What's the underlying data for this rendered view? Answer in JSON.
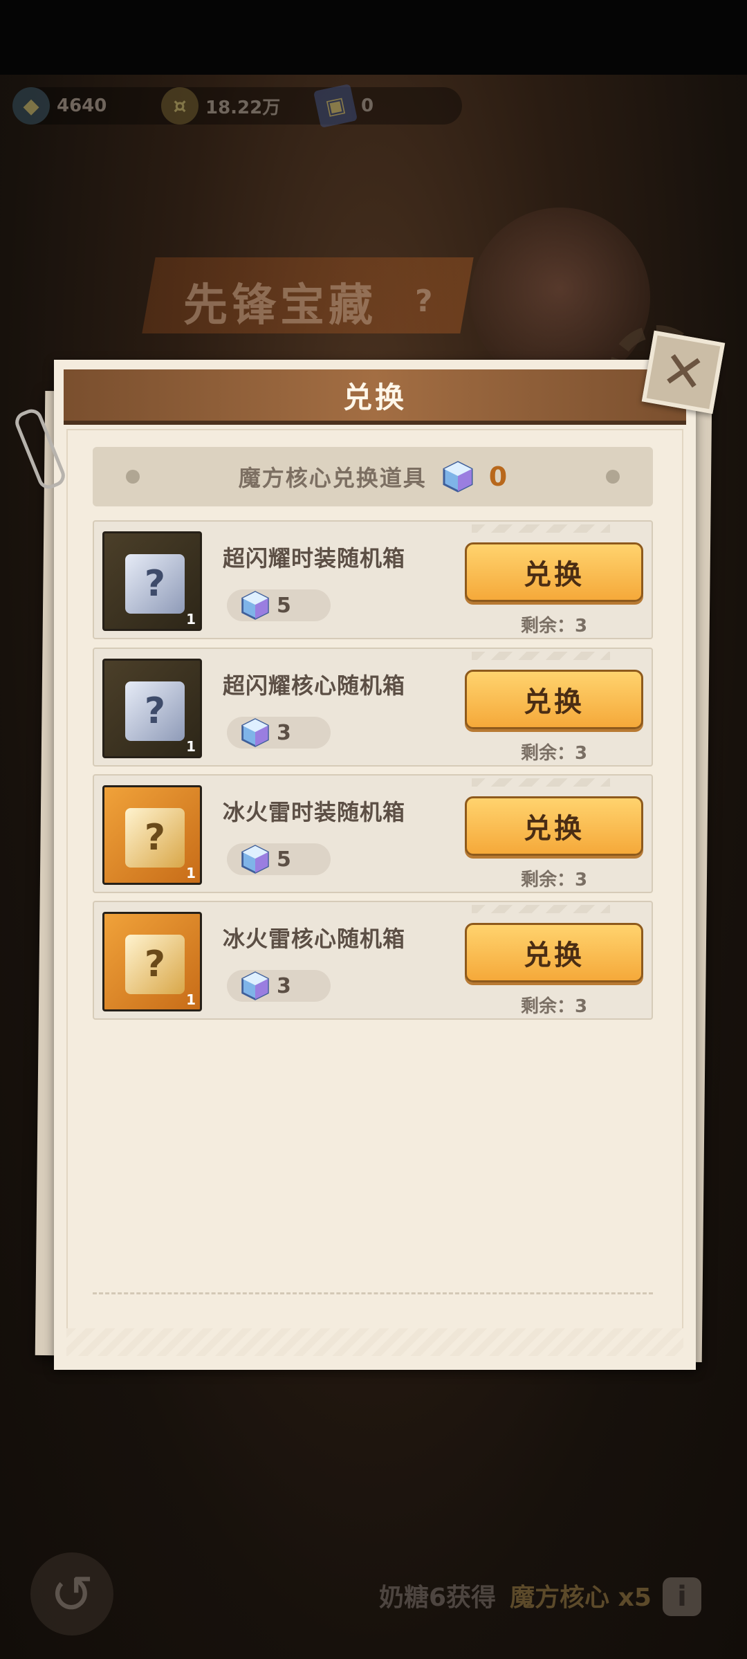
{
  "currency": [
    {
      "value": "4640",
      "icon": "gem-icon"
    },
    {
      "value": "18.22万",
      "icon": "gold-coin-icon"
    },
    {
      "value": "0",
      "icon": "card-icon"
    }
  ],
  "background": {
    "banner_title": "先锋宝藏",
    "banner_help": "?"
  },
  "dialog": {
    "title": "兑换",
    "close_glyph": "✕",
    "subheader_label": "魔方核心兑换道具",
    "owned_count": "0"
  },
  "items": [
    {
      "name": "超闪耀时装随机箱",
      "cost": "5",
      "qty": "1",
      "button": "兑换",
      "remain": "剩余：3",
      "icon_style": "silver"
    },
    {
      "name": "超闪耀核心随机箱",
      "cost": "3",
      "qty": "1",
      "button": "兑换",
      "remain": "剩余：3",
      "icon_style": "silver"
    },
    {
      "name": "冰火雷时装随机箱",
      "cost": "5",
      "qty": "1",
      "button": "兑换",
      "remain": "剩余：3",
      "icon_style": "gold"
    },
    {
      "name": "冰火雷核心随机箱",
      "cost": "3",
      "qty": "1",
      "button": "兑换",
      "remain": "剩余：3",
      "icon_style": "gold"
    }
  ],
  "bottom": {
    "hint_prefix": "奶糖6获得",
    "hint_item": "魔方核心 x5",
    "info": "i",
    "back_glyph": "↺"
  },
  "colors": {
    "button": "#f5a93a",
    "dialog_bg": "#f4ecde",
    "header": "#a36e43",
    "count": "#b8681c"
  }
}
